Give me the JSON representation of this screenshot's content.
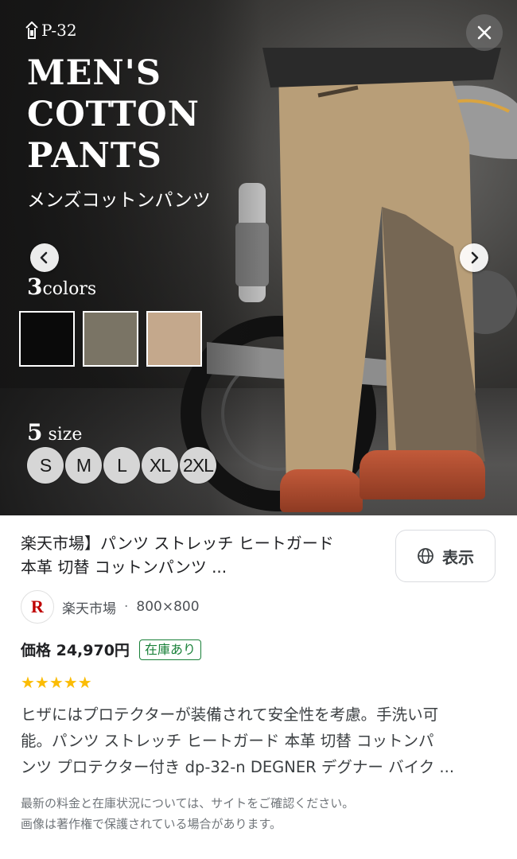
{
  "image": {
    "brand": "P-32",
    "headline": [
      "MEN'S",
      "COTTON",
      "PANTS"
    ],
    "subtitle_jp": "メンズコットンパンツ",
    "colors_count": "3",
    "colors_word": "colors",
    "color_swatches": [
      "#0a0a0a",
      "#7a7465",
      "#c4a88c"
    ],
    "size_count": "5",
    "size_word": "size",
    "sizes": [
      "S",
      "M",
      "L",
      "XL",
      "2XL"
    ]
  },
  "result": {
    "title_lines": [
      "楽天市場】パンツ ストレッチ ヒートガード",
      "本革 切替 コットンパンツ ..."
    ],
    "visit_label": "表示",
    "source_logo": "R",
    "source_name": "楽天市場",
    "source_sep": "·",
    "image_dims": "800×800",
    "price": "価格 24,970円",
    "stock": "在庫あり",
    "stars": "★★★★★",
    "description_lines": [
      "ヒザにはプロテクターが装備されて安全性を考慮。手洗い可",
      "能。パンツ ストレッチ ヒートガード 本革 切替 コットンパ",
      "ンツ プロテクター付き dp-32-n DEGNER デグナー バイク ..."
    ],
    "disclaimer_lines": [
      "最新の料金と在庫状況については、サイトをご確認ください。",
      "画像は著作権で保護されている場合があります。"
    ]
  }
}
